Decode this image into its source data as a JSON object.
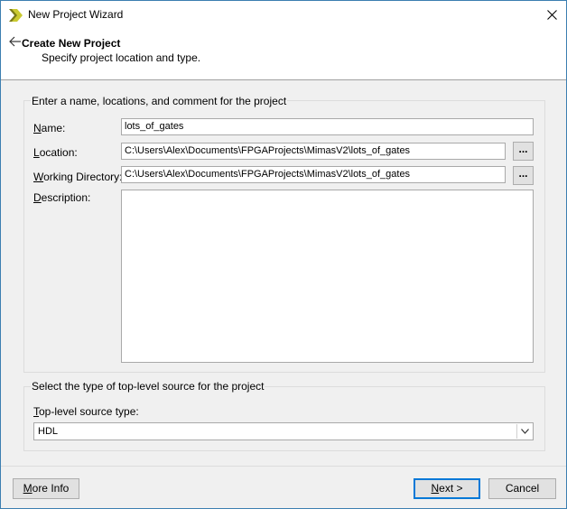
{
  "window": {
    "title": "New Project Wizard",
    "accent_color": "#3c7fb1",
    "icon": "xilinx-logo-icon"
  },
  "header": {
    "title": "Create New Project",
    "subtitle": "Specify project location and type."
  },
  "project_group": {
    "title": "Enter a name, locations, and comment for the project",
    "name_label_key": "N",
    "name_label_rest": "ame:",
    "name_value": "lots_of_gates",
    "location_label_key": "L",
    "location_label_rest": "ocation:",
    "location_value": "C:\\Users\\Alex\\Documents\\FPGAProjects\\MimasV2\\lots_of_gates",
    "workdir_label_key": "W",
    "workdir_label_rest": "orking Directory:",
    "workdir_value": "C:\\Users\\Alex\\Documents\\FPGAProjects\\MimasV2\\lots_of_gates",
    "description_label_key": "D",
    "description_label_rest": "escription:",
    "description_value": "",
    "browse_label": "..."
  },
  "source_group": {
    "title": "Select the type of top-level source for the project",
    "type_label_key": "T",
    "type_label_rest": "op-level source type:",
    "type_value": "HDL"
  },
  "footer": {
    "more_info_key": "M",
    "more_info_rest": "ore Info",
    "next_key": "N",
    "next_rest": "ext >",
    "cancel_label": "Cancel"
  }
}
